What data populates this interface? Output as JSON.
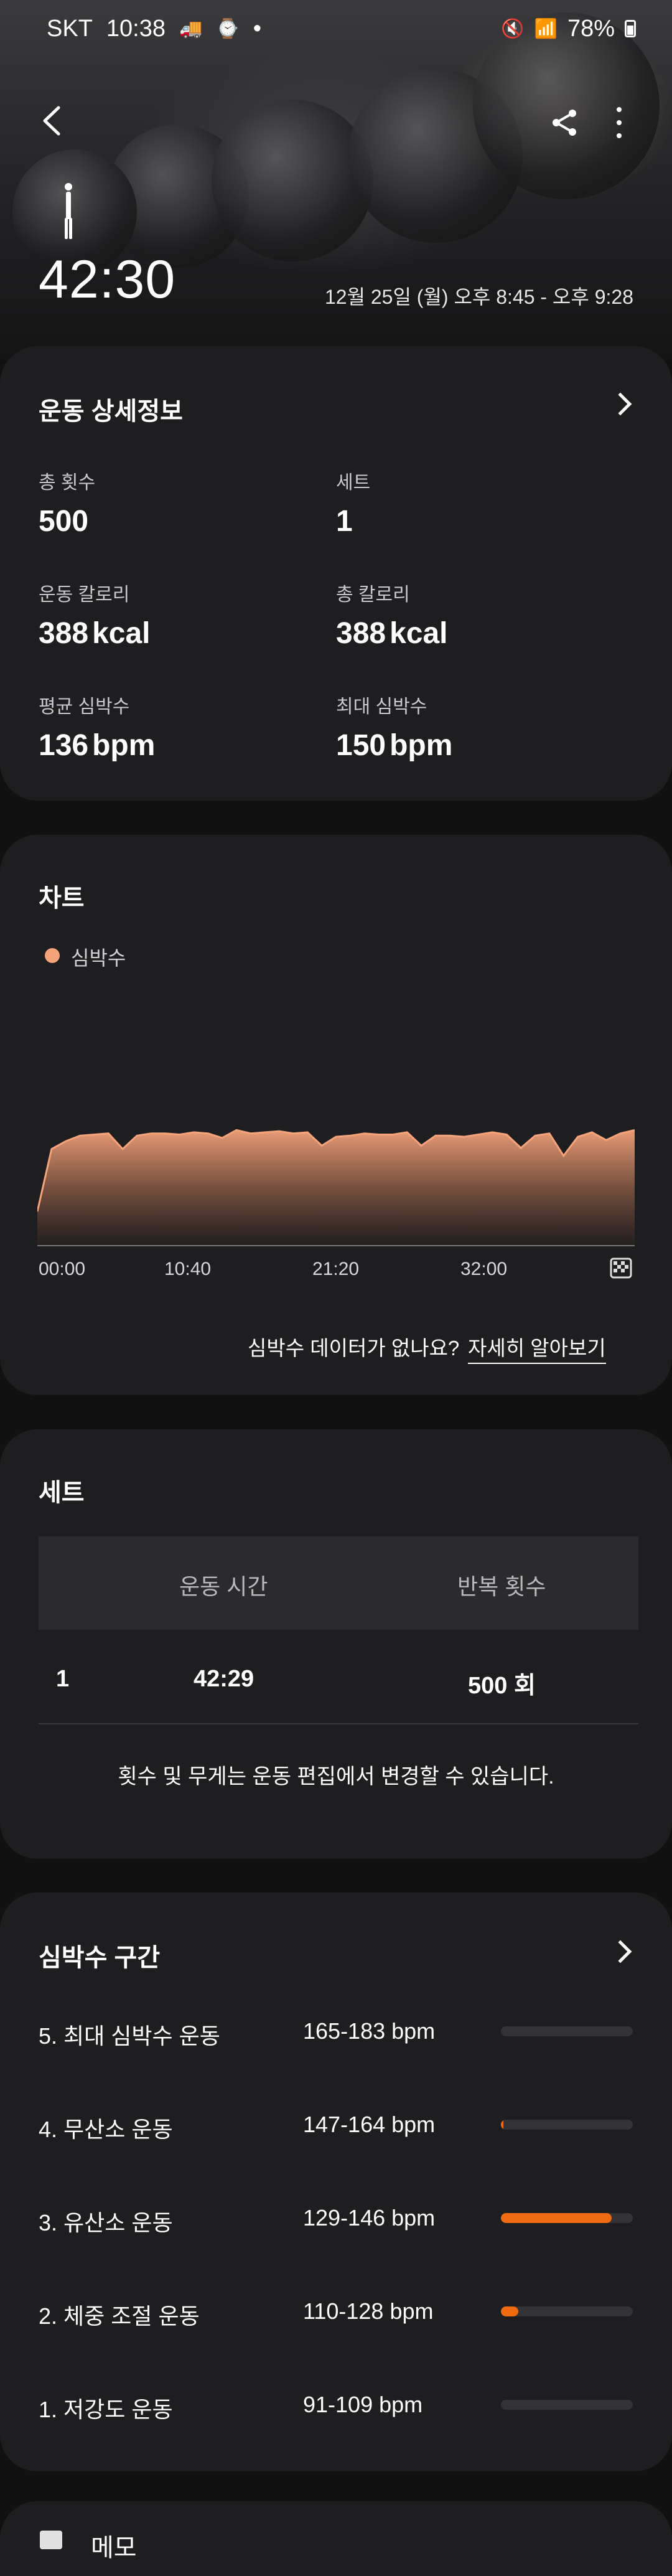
{
  "status_bar": {
    "carrier": "SKT",
    "time": "10:38",
    "dot": "•",
    "battery": "78%"
  },
  "hero": {
    "duration": "42:30",
    "date_range": "12월 25일 (월) 오후 8:45 - 오후 9:28"
  },
  "details": {
    "title": "운동 상세정보",
    "metrics": [
      {
        "label": "총 횟수",
        "value": "500",
        "unit": ""
      },
      {
        "label": "세트",
        "value": "1",
        "unit": ""
      },
      {
        "label": "운동 칼로리",
        "value": "388",
        "unit": "kcal"
      },
      {
        "label": "총 칼로리",
        "value": "388",
        "unit": "kcal"
      },
      {
        "label": "평균 심박수",
        "value": "136",
        "unit": "bpm"
      },
      {
        "label": "최대 심박수",
        "value": "150",
        "unit": "bpm"
      }
    ]
  },
  "chart": {
    "title": "차트",
    "legend": "심박수",
    "ticks": [
      "00:00",
      "10:40",
      "21:20",
      "32:00"
    ],
    "no_data": "심박수 데이터가 없나요?",
    "learn_more": "자세히 알아보기"
  },
  "chart_data": {
    "type": "area",
    "series": [
      {
        "name": "심박수",
        "color": "#f5a37a",
        "x": [
          0,
          1,
          2,
          3,
          4,
          5,
          6,
          7,
          8,
          9,
          10,
          11,
          12,
          13,
          14,
          15,
          16,
          17,
          18,
          19,
          20,
          21,
          22,
          23,
          24,
          25,
          26,
          27,
          28,
          29,
          30,
          31,
          32,
          33,
          34,
          35,
          36,
          37,
          38,
          39,
          40,
          41,
          42
        ],
        "values": [
          70,
          126,
          133,
          138,
          139,
          140,
          126,
          138,
          140,
          140,
          139,
          141,
          140,
          136,
          143,
          140,
          141,
          142,
          140,
          141,
          129,
          137,
          138,
          140,
          139,
          139,
          141,
          129,
          138,
          138,
          137,
          139,
          141,
          139,
          127,
          138,
          140,
          120,
          137,
          141,
          134,
          140,
          143
        ]
      }
    ],
    "x_tick_labels": [
      "00:00",
      "10:40",
      "21:20",
      "32:00"
    ],
    "grid": false
  },
  "sets": {
    "title": "세트",
    "headers": [
      "운동 시간",
      "반복 횟수"
    ],
    "rows": [
      {
        "index": "1",
        "time": "42:29",
        "reps": "500 회"
      }
    ],
    "note": "횟수 및 무게는 운동 편집에서 변경할 수 있습니다."
  },
  "zones": {
    "title": "심박수 구간",
    "items": [
      {
        "name": "5. 최대 심박수 운동",
        "range": "165-183 bpm",
        "fraction": 0.0
      },
      {
        "name": "4. 무산소 운동",
        "range": "147-164 bpm",
        "fraction": 0.02
      },
      {
        "name": "3. 유산소 운동",
        "range": "129-146 bpm",
        "fraction": 0.84
      },
      {
        "name": "2. 체중 조절 운동",
        "range": "110-128 bpm",
        "fraction": 0.13
      },
      {
        "name": "1. 저강도 운동",
        "range": "91-109 bpm",
        "fraction": 0.0
      }
    ]
  },
  "memo": {
    "label": "메모"
  }
}
